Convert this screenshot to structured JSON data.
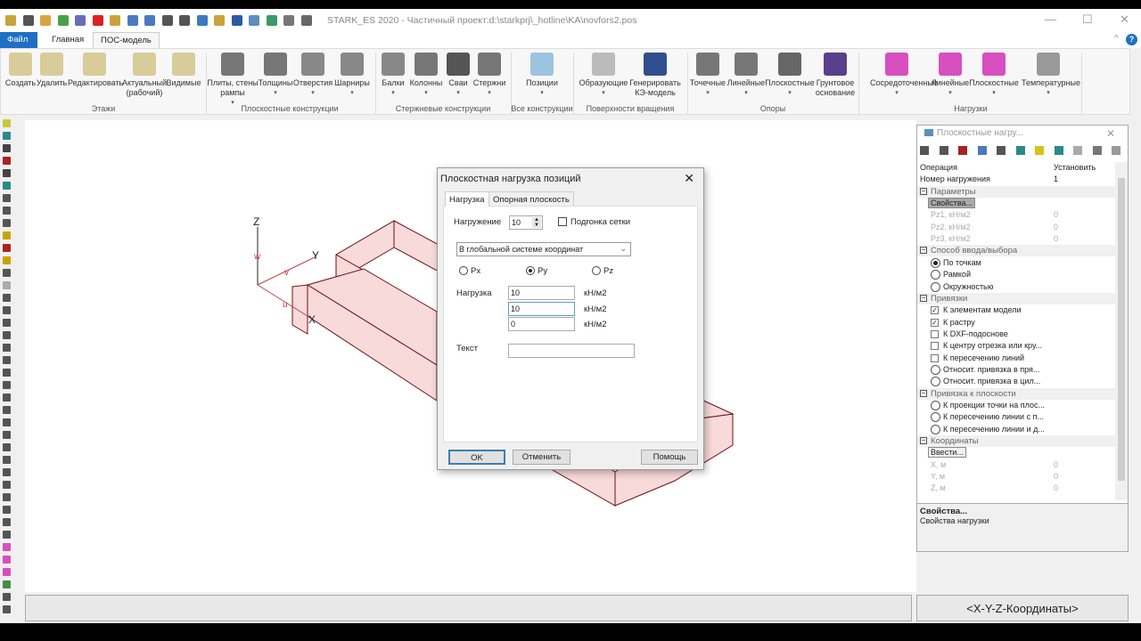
{
  "window": {
    "title": "STARK_ES 2020 - Частичный проект:d:\\starkprj\\_hotline\\KA\\novfors2.pos",
    "minimize": "—",
    "maximize": "☐",
    "close": "✕",
    "collapse": "^",
    "help": "?"
  },
  "tabs": [
    {
      "label": "Файл"
    },
    {
      "label": "Главная"
    },
    {
      "label": "ПОС-модель"
    }
  ],
  "ribbon": {
    "groups": [
      {
        "label": "Этажи"
      },
      {
        "label": "Плоскостные конструкции"
      },
      {
        "label": "Стержневые конструкции"
      },
      {
        "label": "Все конструкции"
      },
      {
        "label": "Поверхности вращения"
      },
      {
        "label": "Опоры"
      },
      {
        "label": "Нагрузки"
      }
    ],
    "buttons": [
      {
        "label": "Создать",
        "icon": "floor-add-icon",
        "color": "#d8cc9a",
        "dd": false
      },
      {
        "label": "Удалить",
        "icon": "floor-delete-icon",
        "color": "#d8cc9a",
        "dd": false
      },
      {
        "label": "Редактировать",
        "icon": "floor-edit-icon",
        "color": "#d8cc9a",
        "dd": false
      },
      {
        "label": "Актуальный (рабочий)",
        "icon": "floor-current-icon",
        "color": "#d8cc9a",
        "dd": false
      },
      {
        "label": "Видимые",
        "icon": "floor-visible-icon",
        "color": "#d8cc9a",
        "dd": false
      },
      {
        "label": "Плиты, стены рампы",
        "icon": "slabs-icon",
        "color": "#777",
        "dd": true
      },
      {
        "label": "Толщины",
        "icon": "thickness-icon",
        "color": "#777",
        "dd": true
      },
      {
        "label": "Отверстия",
        "icon": "openings-icon",
        "color": "#888",
        "dd": true
      },
      {
        "label": "Шарниры",
        "icon": "hinges-icon",
        "color": "#888",
        "dd": true
      },
      {
        "label": "Балки",
        "icon": "beams-icon",
        "color": "#888",
        "dd": true
      },
      {
        "label": "Колонны",
        "icon": "columns-icon",
        "color": "#777",
        "dd": true
      },
      {
        "label": "Сваи",
        "icon": "piles-icon",
        "color": "#555",
        "dd": true
      },
      {
        "label": "Стержни",
        "icon": "bars-icon",
        "color": "#777",
        "dd": true
      },
      {
        "label": "Позиции",
        "icon": "positions-icon",
        "color": "#9cc3e0",
        "dd": true
      },
      {
        "label": "Образующие",
        "icon": "generatrix-icon",
        "color": "#bbb",
        "dd": true
      },
      {
        "label": "Генерировать КЭ-модель",
        "icon": "generate-fe-icon",
        "color": "#2f4f8f",
        "dd": false
      },
      {
        "label": "Точечные",
        "icon": "point-supports-icon",
        "color": "#777",
        "dd": true
      },
      {
        "label": "Линейные",
        "icon": "line-supports-icon",
        "color": "#777",
        "dd": true
      },
      {
        "label": "Плоскостные",
        "icon": "area-supports-icon",
        "color": "#666",
        "dd": true
      },
      {
        "label": "Грунтовое основание",
        "icon": "soil-base-icon",
        "color": "#5a3f8a",
        "dd": false
      },
      {
        "label": "Сосредоточенные",
        "icon": "point-load-icon",
        "color": "#d84fbf",
        "dd": true
      },
      {
        "label": "Линейные",
        "icon": "line-load-icon",
        "color": "#d84fbf",
        "dd": true
      },
      {
        "label": "Плоскостные",
        "icon": "area-load-icon",
        "color": "#d84fbf",
        "dd": true
      },
      {
        "label": "Температурные",
        "icon": "temperature-load-icon",
        "color": "#999",
        "dd": true
      }
    ]
  },
  "canvas": {
    "axes": {
      "z": "Z",
      "y": "Y",
      "x": "X",
      "w": "w",
      "v": "v",
      "u": "u"
    },
    "model_fill": "#f9dada",
    "model_stroke": "#6b1010"
  },
  "dialog": {
    "title": "Плоскостная нагрузка позиций",
    "close": "✕",
    "tabs": [
      {
        "label": "Нагрузка"
      },
      {
        "label": "Опорная плоскость"
      }
    ],
    "loadcase_label": "Нагружение",
    "loadcase_value": "10",
    "mesh_fit_label": "Подгонка сетки",
    "mesh_fit_checked": false,
    "coord_system": "В глобальной системе координат",
    "directions": [
      {
        "label": "Px",
        "selected": false
      },
      {
        "label": "Py",
        "selected": true
      },
      {
        "label": "Pz",
        "selected": false
      }
    ],
    "load_label": "Нагрузка",
    "loads": [
      {
        "value": "10",
        "unit": "кН/м2"
      },
      {
        "value": "10",
        "unit": "кН/м2"
      },
      {
        "value": "0",
        "unit": "кН/м2"
      }
    ],
    "text_label": "Текст",
    "text_value": "",
    "ok": "OK",
    "cancel": "Отменить",
    "help": "Помощь"
  },
  "panel": {
    "title": "Плоскостные нагру...",
    "close": "✕",
    "rows": [
      {
        "type": "kv",
        "k": "Операция",
        "v": "Установить"
      },
      {
        "type": "kv",
        "k": "Номер нагружения",
        "v": "1"
      },
      {
        "type": "hdr",
        "k": "Параметры"
      },
      {
        "type": "btn",
        "k": "Свойства..."
      },
      {
        "type": "dis",
        "k": "Pz1, кН/м2",
        "v": "0"
      },
      {
        "type": "dis",
        "k": "Pz2, кН/м2",
        "v": "0"
      },
      {
        "type": "dis",
        "k": "Pz3, кН/м2",
        "v": "0"
      },
      {
        "type": "hdr",
        "k": "Способ ввода/выбора"
      },
      {
        "type": "radio",
        "k": "По точкам",
        "on": true
      },
      {
        "type": "radio",
        "k": "Рамкой",
        "on": false
      },
      {
        "type": "radio",
        "k": "Окружностью",
        "on": false
      },
      {
        "type": "hdr",
        "k": "Привязки"
      },
      {
        "type": "check",
        "k": "К элементам модели",
        "on": true
      },
      {
        "type": "check",
        "k": "К растру",
        "on": true
      },
      {
        "type": "check",
        "k": "К DXF-подоснове",
        "on": false
      },
      {
        "type": "check",
        "k": "К центру отрезка или кру...",
        "on": false
      },
      {
        "type": "check",
        "k": "К пересечению линий",
        "on": false
      },
      {
        "type": "radio",
        "k": "Относит. привязка в пря...",
        "on": false
      },
      {
        "type": "radio",
        "k": "Относит. привязка в цил...",
        "on": false
      },
      {
        "type": "hdr",
        "k": "Привязка к плоскости"
      },
      {
        "type": "radio",
        "k": "К проекции точки на плос...",
        "on": false
      },
      {
        "type": "radio",
        "k": "К пересечению линии с п...",
        "on": false
      },
      {
        "type": "radio",
        "k": "К пересечению линии и д...",
        "on": false
      },
      {
        "type": "hdr",
        "k": "Координаты"
      },
      {
        "type": "btn",
        "k": "Ввести..."
      },
      {
        "type": "dis",
        "k": "X, м",
        "v": "0"
      },
      {
        "type": "dis",
        "k": "Y, м",
        "v": "0"
      },
      {
        "type": "dis",
        "k": "Z, м",
        "v": "0"
      }
    ],
    "desc_title": "Свойства...",
    "desc_text": "Свойства нагрузки"
  },
  "status": {
    "coords": "<X-Y-Z-Координаты>"
  }
}
